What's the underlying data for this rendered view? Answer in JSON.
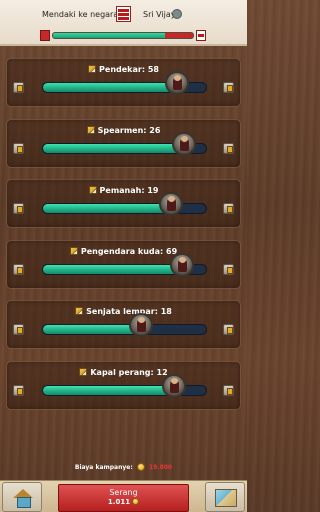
{
  "header": {
    "attacker_label": "Mendaki ke negara",
    "target_label": "Sri Vijaya",
    "balance_fraction": 0.8
  },
  "units": [
    {
      "name": "Pendekar",
      "count": 58,
      "title": "Pendekar: 58",
      "fill": 0.82
    },
    {
      "name": "Spearmen",
      "count": 26,
      "title": "Spearmen: 26",
      "fill": 0.86
    },
    {
      "name": "Pemanah",
      "count": 19,
      "title": "Pemanah: 19",
      "fill": 0.78
    },
    {
      "name": "Pengendara kuda",
      "count": 69,
      "title": "Pengendara kuda: 69",
      "fill": 0.85
    },
    {
      "name": "Senjata lempar",
      "count": 18,
      "title": "Senjata lempar: 18",
      "fill": 0.6
    },
    {
      "name": "Kapal perang",
      "count": 12,
      "title": "Kapal perang: 12",
      "fill": 0.8
    }
  ],
  "budget": {
    "label": "Biaya kampanye:",
    "value": "19.800"
  },
  "attack": {
    "label": "Serang",
    "cost": "1.011"
  },
  "colors": {
    "bar_fill": "#21b186",
    "attack_button": "#c62828",
    "cost_red": "#e53935"
  },
  "icons": [
    "pencil-icon",
    "coin-icon",
    "home-icon",
    "map-icon",
    "globe-icon",
    "flag-icon",
    "unit-icon",
    "stepper-icon"
  ]
}
